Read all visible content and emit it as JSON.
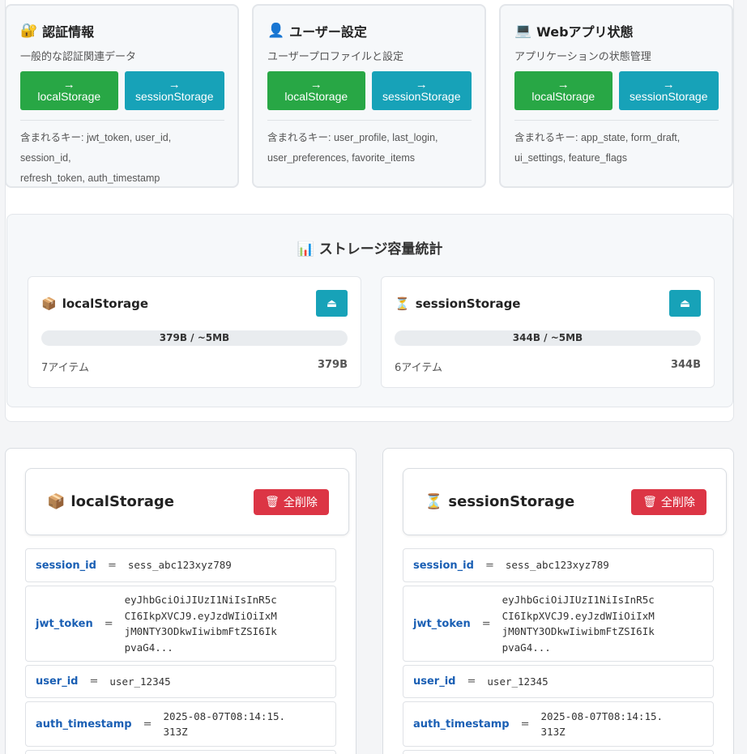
{
  "categories": [
    {
      "icon": "🔐",
      "title": "認証情報",
      "subtitle": "一般的な認証関連データ",
      "keys_prefix": "含まれるキー: ",
      "keys_line1": "jwt_token, user_id, session_id,",
      "keys_line2": "refresh_token, auth_timestamp"
    },
    {
      "icon": "👤",
      "title": "ユーザー設定",
      "subtitle": "ユーザープロファイルと設定",
      "keys_prefix": "含まれるキー: ",
      "keys_line1": "user_profile, last_login,",
      "keys_line2": "user_preferences, favorite_items"
    },
    {
      "icon": "💻",
      "title": "Webアプリ状態",
      "subtitle": "アプリケーションの状態管理",
      "keys_prefix": "含まれるキー: ",
      "keys_line1": "app_state, form_draft,",
      "keys_line2": "ui_settings, feature_flags"
    }
  ],
  "move_buttons": {
    "arrow": "→",
    "local_label": "localStorage",
    "session_label": "sessionStorage"
  },
  "stats": {
    "title": "📊 ストレージ容量統計",
    "local": {
      "icon": "📦",
      "name": "localStorage",
      "usage": "379B / ~5MB",
      "items": "7アイテム",
      "size": "379B",
      "btn_icon": "⏏"
    },
    "session": {
      "icon": "⏳",
      "name": "sessionStorage",
      "usage": "344B / ~5MB",
      "items": "6アイテム",
      "size": "344B",
      "btn_icon": "⏏"
    }
  },
  "panels": {
    "local": {
      "icon": "📦",
      "title": "localStorage",
      "clear_label": "全削除",
      "clear_icon": "🗑"
    },
    "session": {
      "icon": "⏳",
      "title": "sessionStorage",
      "clear_label": "全削除",
      "clear_icon": "🗑"
    }
  },
  "entries": [
    {
      "key": "session_id",
      "eq": "=",
      "value": "sess_abc123xyz789"
    },
    {
      "key": "jwt_token",
      "eq": "=",
      "value": "eyJhbGciOiJIUzI1NiIsInR5c\nCI6IkpXVCJ9.eyJzdWIiOiIxM\njM0NTY3ODkwIiwibmFtZSI6Ik\npvaG4..."
    },
    {
      "key": "user_id",
      "eq": "=",
      "value": "user_12345"
    },
    {
      "key": "auth_timestamp",
      "eq": "=",
      "value": "2025-08-07T08:14:15.\n313Z"
    }
  ]
}
